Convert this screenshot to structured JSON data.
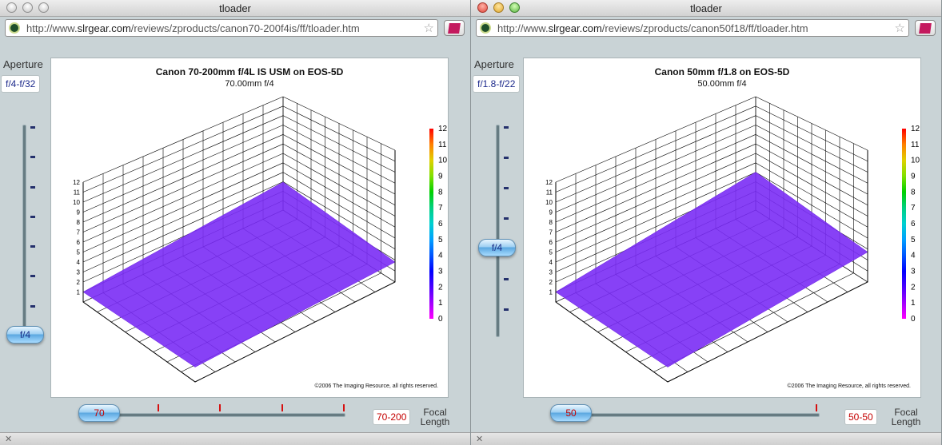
{
  "windows": [
    {
      "title": "tloader",
      "url_prefix": "http://www.",
      "url_domain": "slrgear.com",
      "url_path": "/reviews/zproducts/canon70-200f4is/ff/tloader.htm",
      "aperture_label": "Aperture",
      "aperture_range": "f/4-f/32",
      "aperture_value": "f/4",
      "chart_title": "Canon 70-200mm f/4L IS USM on EOS-5D",
      "chart_subtitle": "70.00mm f/4",
      "copyright": "©2006 The Imaging Resource, all rights reserved.",
      "focal_value": "70",
      "focal_range": "70-200",
      "focal_label": "Focal Length"
    },
    {
      "title": "tloader",
      "url_prefix": "http://www.",
      "url_domain": "slrgear.com",
      "url_path": "/reviews/zproducts/canon50f18/ff/tloader.htm",
      "aperture_label": "Aperture",
      "aperture_range": "f/1.8-f/22",
      "aperture_value": "f/4",
      "chart_title": "Canon 50mm f/1.8 on EOS-5D",
      "chart_subtitle": "50.00mm f/4",
      "copyright": "©2006 The Imaging Resource, all rights reserved.",
      "focal_value": "50",
      "focal_range": "50-50",
      "focal_label": "Focal Length"
    }
  ],
  "colors": {
    "surface_fill": "#7a2cf5",
    "window_bg": "#c9d3d6",
    "slider_text": "#1a2f88",
    "focal_text": "#c40000"
  },
  "chart_data": [
    {
      "type": "surface",
      "title": "Canon 70-200mm f/4L IS USM on EOS-5D",
      "subtitle": "70.00mm f/4",
      "zlim": [
        0,
        12
      ],
      "z_ticks": [
        1,
        2,
        3,
        4,
        5,
        6,
        7,
        8,
        9,
        10,
        11,
        12
      ],
      "colorbar_ticks": [
        0,
        1,
        2,
        3,
        4,
        5,
        6,
        7,
        8,
        9,
        10,
        11,
        12
      ],
      "surface_approx_level": [
        1,
        2
      ]
    },
    {
      "type": "surface",
      "title": "Canon 50mm f/1.8 on EOS-5D",
      "subtitle": "50.00mm f/4",
      "zlim": [
        0,
        12
      ],
      "z_ticks": [
        1,
        2,
        3,
        4,
        5,
        6,
        7,
        8,
        9,
        10,
        11,
        12
      ],
      "colorbar_ticks": [
        0,
        1,
        2,
        3,
        4,
        5,
        6,
        7,
        8,
        9,
        10,
        11,
        12
      ],
      "surface_approx_level": [
        1,
        3
      ]
    }
  ]
}
